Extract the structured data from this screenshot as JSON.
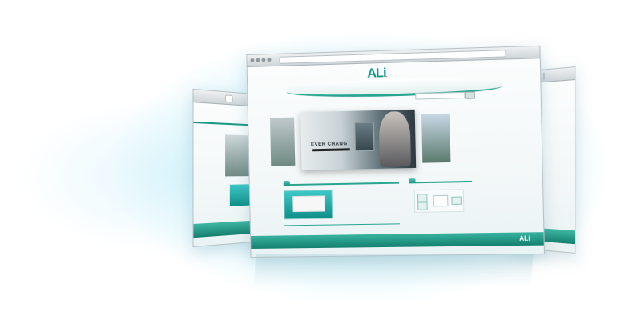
{
  "site": {
    "logo": "ALi",
    "logo_dot": ".",
    "top_links": [
      "",
      "",
      ""
    ],
    "nav": [
      "",
      "",
      "",
      "",
      "",
      "",
      ""
    ],
    "search_placeholder": "",
    "search_button": ""
  },
  "banner": {
    "title": "EVER CHANG",
    "tag": ""
  },
  "panels": {
    "news": {
      "head": "",
      "more": "",
      "items": [
        "",
        "",
        "",
        "",
        ""
      ]
    },
    "info": {
      "head": "",
      "more": "",
      "lines": [
        "",
        "",
        "",
        "",
        ""
      ]
    }
  },
  "footer": {
    "left": "",
    "text": "",
    "logo": "ALi"
  },
  "colors": {
    "accent": "#1a9583",
    "accent_light": "#4bc0ac",
    "glow": "#96e1f5"
  }
}
